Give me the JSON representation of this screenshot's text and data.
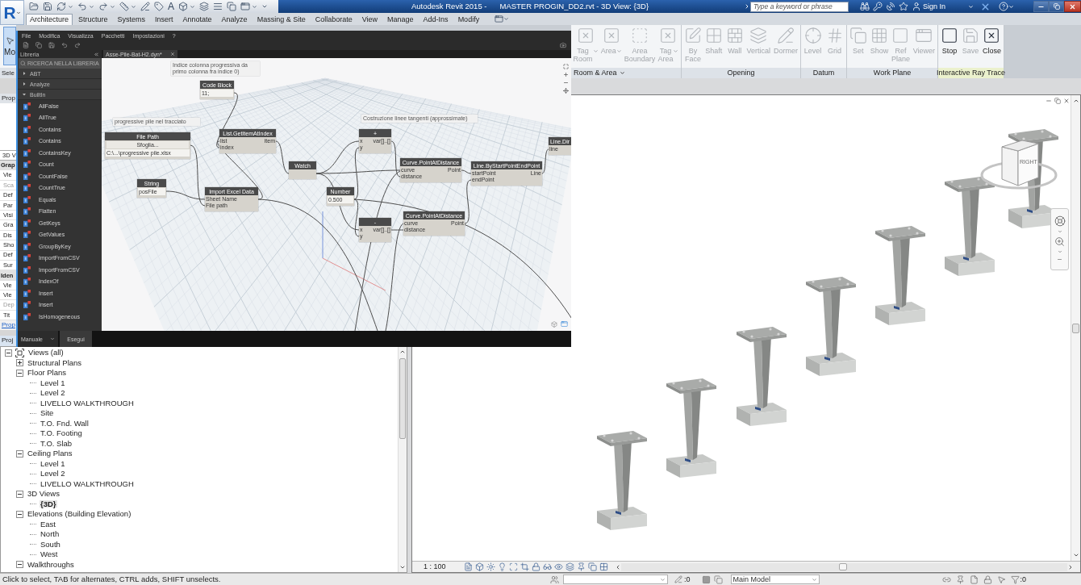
{
  "title_bar": {
    "app_logo": "R",
    "text_tool": "A",
    "app_title": "Autodesk Revit 2015 -",
    "document_title": "MASTER PROGIN_DD2.rvt - 3D View: {3D}",
    "search": {
      "placeholder": "Type a keyword or phrase"
    },
    "sign_in": "Sign In"
  },
  "ribbon_tabs": [
    {
      "label": "Architecture",
      "selected": true
    },
    {
      "label": "Structure",
      "selected": false
    },
    {
      "label": "Systems",
      "selected": false
    },
    {
      "label": "Insert",
      "selected": false
    },
    {
      "label": "Annotate",
      "selected": false
    },
    {
      "label": "Analyze",
      "selected": false
    },
    {
      "label": "Massing & Site",
      "selected": false
    },
    {
      "label": "Collaborate",
      "selected": false
    },
    {
      "label": "View",
      "selected": false
    },
    {
      "label": "Manage",
      "selected": false
    },
    {
      "label": "Add-Ins",
      "selected": false
    },
    {
      "label": "Modify",
      "selected": false
    }
  ],
  "ribbon": {
    "modify_button": {
      "label": "Mo",
      "selected": true
    },
    "select_label": "Sele",
    "panels": [
      {
        "title": "Room & Area",
        "menu": true,
        "highlighted": false,
        "buttons": [
          {
            "label": "Tag Room",
            "disabled": true,
            "menu": true
          },
          {
            "label": "Area",
            "disabled": true,
            "menu": true
          },
          {
            "label": "Area Boundary",
            "disabled": true,
            "menu": false
          },
          {
            "label": "Tag Area",
            "disabled": true,
            "menu": true
          }
        ]
      },
      {
        "title": "Opening",
        "menu": false,
        "highlighted": false,
        "buttons": [
          {
            "label": "By Face",
            "disabled": true,
            "menu": false
          },
          {
            "label": "Shaft",
            "disabled": true,
            "menu": false
          },
          {
            "label": "Wall",
            "disabled": true,
            "menu": false
          },
          {
            "label": "Vertical",
            "disabled": true,
            "menu": false
          },
          {
            "label": "Dormer",
            "disabled": true,
            "menu": false
          }
        ]
      },
      {
        "title": "Datum",
        "menu": false,
        "highlighted": false,
        "buttons": [
          {
            "label": "Level",
            "disabled": true,
            "menu": false
          },
          {
            "label": "Grid",
            "disabled": true,
            "menu": false
          }
        ]
      },
      {
        "title": "Work Plane",
        "menu": false,
        "highlighted": false,
        "buttons": [
          {
            "label": "Set",
            "disabled": true,
            "menu": false
          },
          {
            "label": "Show",
            "disabled": true,
            "menu": false
          },
          {
            "label": "Ref Plane",
            "disabled": true,
            "menu": false
          },
          {
            "label": "Viewer",
            "disabled": true,
            "menu": false
          }
        ]
      },
      {
        "title": "Interactive Ray Trace",
        "menu": false,
        "highlighted": true,
        "buttons": [
          {
            "label": "Stop",
            "disabled": false,
            "menu": false
          },
          {
            "label": "Save",
            "disabled": true,
            "menu": false
          },
          {
            "label": "Close",
            "disabled": false,
            "menu": false
          }
        ]
      }
    ]
  },
  "properties": {
    "title": "Prop",
    "rows": [
      {
        "kind": "type",
        "text": "3D V"
      },
      {
        "kind": "group",
        "text": "Grap"
      },
      {
        "kind": "field",
        "text": "Vie",
        "disabled": false
      },
      {
        "kind": "field",
        "text": "Sca",
        "disabled": true
      },
      {
        "kind": "field",
        "text": "Def",
        "disabled": false
      },
      {
        "kind": "field",
        "text": "Par",
        "disabled": false
      },
      {
        "kind": "field",
        "text": "Visi",
        "disabled": false
      },
      {
        "kind": "field",
        "text": "Gra",
        "disabled": false
      },
      {
        "kind": "field",
        "text": "Dis",
        "disabled": false
      },
      {
        "kind": "field",
        "text": "Sho",
        "disabled": false
      },
      {
        "kind": "field",
        "text": "Def",
        "disabled": false
      },
      {
        "kind": "field",
        "text": "Sur",
        "disabled": false
      },
      {
        "kind": "group",
        "text": "Iden"
      },
      {
        "kind": "field",
        "text": "Vie",
        "disabled": false
      },
      {
        "kind": "field",
        "text": "Vie",
        "disabled": false
      },
      {
        "kind": "field",
        "text": "Dep",
        "disabled": true
      },
      {
        "kind": "field",
        "text": "Tit",
        "disabled": false
      }
    ],
    "link": "Prop"
  },
  "project_browser": {
    "title": "Proj",
    "tree": [
      {
        "label": "Views (all)",
        "expanded": true,
        "children": [
          {
            "label": "Structural Plans",
            "expanded": false
          },
          {
            "label": "Floor Plans",
            "expanded": true,
            "children": [
              {
                "label": "Level 1",
                "active": false
              },
              {
                "label": "Level 2",
                "active": false
              },
              {
                "label": "LIVELLO WALKTHROUGH",
                "active": false
              },
              {
                "label": "Site",
                "active": false
              },
              {
                "label": "T.O. Fnd. Wall",
                "active": false
              },
              {
                "label": "T.O. Footing",
                "active": false
              },
              {
                "label": "T.O. Slab",
                "active": false
              }
            ]
          },
          {
            "label": "Ceiling Plans",
            "expanded": true,
            "children": [
              {
                "label": "Level 1",
                "active": false
              },
              {
                "label": "Level 2",
                "active": false
              },
              {
                "label": "LIVELLO WALKTHROUGH",
                "active": false
              }
            ]
          },
          {
            "label": "3D Views",
            "expanded": true,
            "children": [
              {
                "label": "{3D}",
                "active": true
              }
            ]
          },
          {
            "label": "Elevations (Building Elevation)",
            "expanded": true,
            "children": [
              {
                "label": "East",
                "active": false
              },
              {
                "label": "North",
                "active": false
              },
              {
                "label": "South",
                "active": false
              },
              {
                "label": "West",
                "active": false
              }
            ]
          },
          {
            "label": "Walkthroughs",
            "expanded": true
          }
        ]
      }
    ]
  },
  "dynamo": {
    "menu": [
      "File",
      "Modifica",
      "Visualizza",
      "Pacchetti",
      "Impostazioni",
      "?"
    ],
    "library": {
      "title": "Libreria",
      "search": {
        "placeholder": "RICERCA NELLA LIBRERIA"
      },
      "categories": [
        {
          "label": "ABT",
          "expanded": false
        },
        {
          "label": "Analyze",
          "expanded": false
        },
        {
          "label": "BuiltIn",
          "expanded": true,
          "children": [
            {
              "label": "AllFalse"
            },
            {
              "label": "AllTrue"
            },
            {
              "label": "Contains"
            },
            {
              "label": "Contains"
            },
            {
              "label": "ContainsKey"
            },
            {
              "label": "Count"
            },
            {
              "label": "CountFalse"
            },
            {
              "label": "CountTrue"
            },
            {
              "label": "Equals"
            },
            {
              "label": "Flatten"
            },
            {
              "label": "GetKeys"
            },
            {
              "label": "GetValues"
            },
            {
              "label": "GroupByKey"
            },
            {
              "label": "ImportFromCSV"
            },
            {
              "label": "ImportFromCSV"
            },
            {
              "label": "IndexOf"
            },
            {
              "label": "Insert"
            },
            {
              "label": "Insert"
            },
            {
              "label": "IsHomogeneous"
            }
          ]
        }
      ]
    },
    "tab": {
      "label": "Asse-Pile-Bat-H2.dyn*"
    },
    "notes": [
      {
        "text": "Indice colonna progressiva da primo colonna fra indice 0)"
      },
      {
        "text": "progressive pile nel tracciato"
      },
      {
        "text": "Costruzione linee tangenti (approssimate)"
      }
    ],
    "nodes": [
      {
        "title": "Code Block",
        "value": "11;"
      },
      {
        "title": "File Path",
        "button": "Sfoglia...",
        "value": "C:\\...\\progressive pile.xlsx"
      },
      {
        "title": "List.GetItemAtIndex",
        "inputs": [
          "list",
          "index"
        ],
        "outputs": [
          "item"
        ]
      },
      {
        "title": "String",
        "value": "posFile"
      },
      {
        "title": "Import Excel Data",
        "inputs": [
          "Sheet Name",
          "File path"
        ]
      },
      {
        "title": "Watch"
      },
      {
        "title": "Number",
        "value": "0.500"
      },
      {
        "title": "+",
        "inputs": [
          "x",
          "y"
        ],
        "outputs": [
          "var[]..[]"
        ]
      },
      {
        "title": "Curve.PointAtDistance",
        "inputs": [
          "curve",
          "distance"
        ],
        "outputs": [
          "Point"
        ]
      },
      {
        "title": "Line.ByStartPointEndPoint",
        "inputs": [
          "startPoint",
          "endPoint"
        ],
        "outputs": [
          "Line"
        ]
      },
      {
        "title": "Line.Dir",
        "inputs": [
          "line"
        ]
      },
      {
        "title": "-",
        "inputs": [
          "x",
          "y"
        ],
        "outputs": [
          "var[]..[]"
        ]
      },
      {
        "title": "Curve.PointAtDistance",
        "inputs": [
          "curve",
          "distance"
        ],
        "outputs": [
          "Point"
        ]
      }
    ],
    "run_mode": "Manuale",
    "run_button": "Esegui"
  },
  "view": {
    "view_cube_label": "RIGHT",
    "scale": "1 : 100"
  },
  "status_bar": {
    "message": "Click to select, TAB for alternates, CTRL adds, SHIFT unselects.",
    "editable_count": ":0",
    "design_option": "Main Model",
    "filter_count": ":0"
  }
}
